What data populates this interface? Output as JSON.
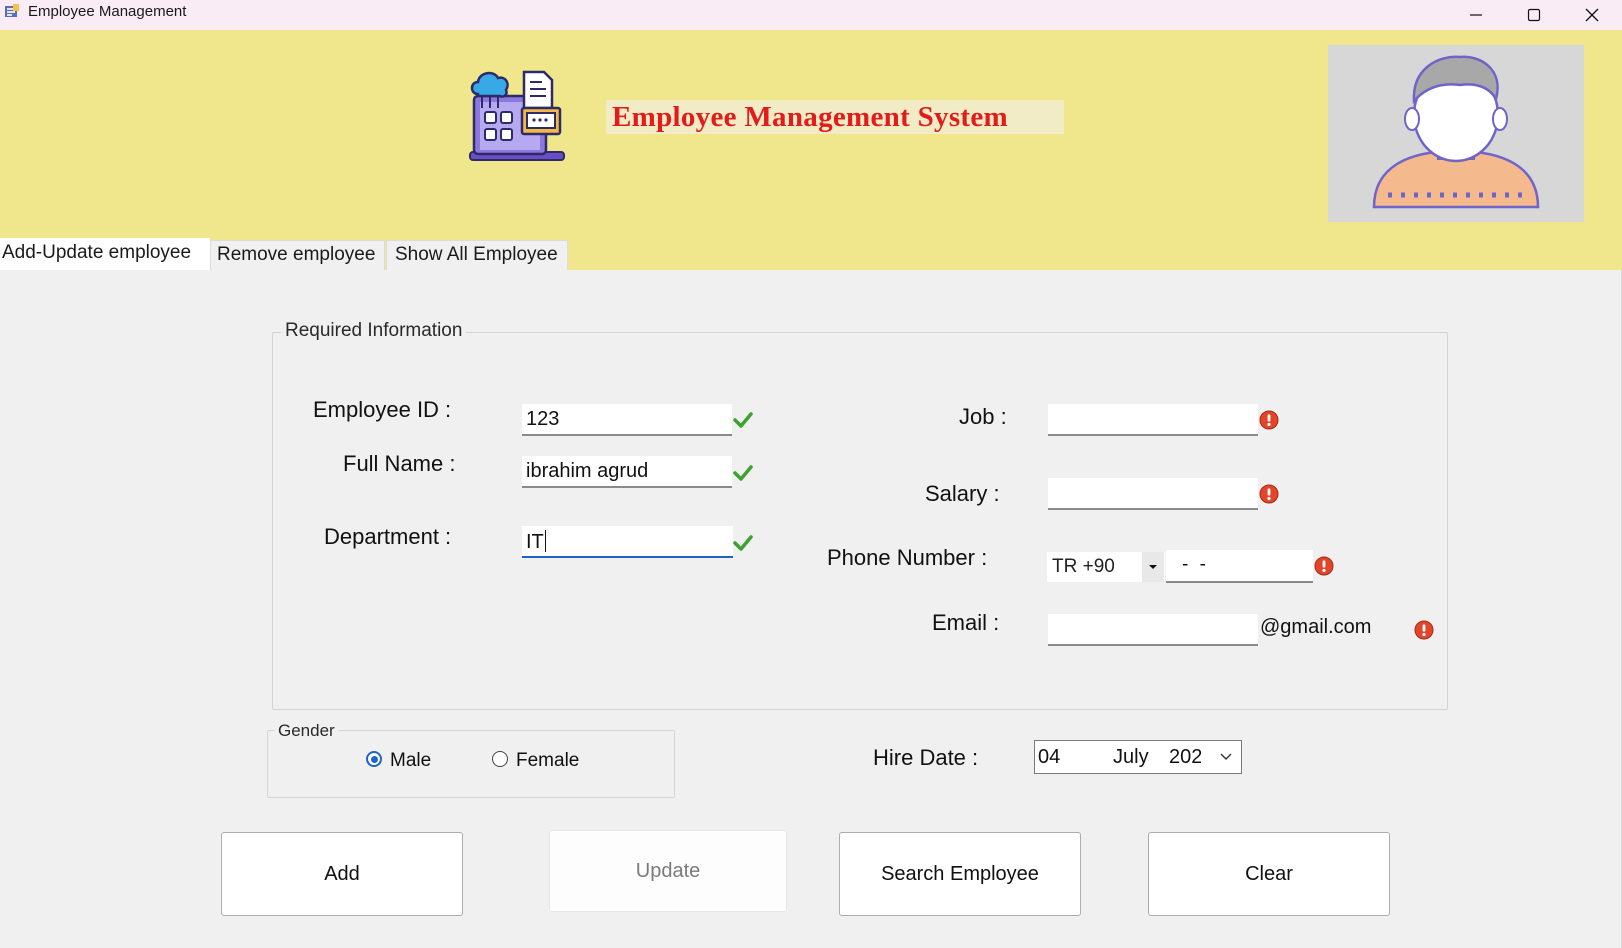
{
  "window": {
    "title": "Employee Management",
    "controls": {
      "minimize_icon": "minimize-icon",
      "maximize_icon": "maximize-icon",
      "close_icon": "close-icon"
    }
  },
  "header": {
    "app_title": "Employee Management System",
    "logo_icon": "cloud-computing-laptop-icon",
    "avatar_icon": "user-avatar-icon",
    "background": "#f0e68c",
    "title_color": "#e41b1b"
  },
  "tabs": [
    {
      "label": "Add-Update employee",
      "active": true
    },
    {
      "label": "Remove employee",
      "active": false
    },
    {
      "label": "Show All Employee",
      "active": false
    }
  ],
  "required_info": {
    "legend": "Required Information",
    "employee_id": {
      "label": "Employee ID :",
      "value": "123",
      "valid": true
    },
    "full_name": {
      "label": "Full Name :",
      "value": "ibrahim agrud",
      "valid": true
    },
    "department": {
      "label": "Department :",
      "value": "IT",
      "valid": true
    },
    "job": {
      "label": "Job :",
      "value": "",
      "valid": false
    },
    "salary": {
      "label": "Salary :",
      "value": "",
      "valid": false
    },
    "phone": {
      "label": "Phone Number :",
      "country_code": "TR +90",
      "mask": "- -",
      "valid": false
    },
    "email": {
      "label": "Email :",
      "value": "",
      "suffix": "@gmail.com",
      "valid": false
    }
  },
  "gender": {
    "legend": "Gender",
    "options": [
      {
        "label": "Male",
        "checked": true
      },
      {
        "label": "Female",
        "checked": false
      }
    ]
  },
  "hire_date": {
    "label": "Hire Date :",
    "day": "04",
    "month": "July",
    "year": "202"
  },
  "buttons": {
    "add": "Add",
    "update": "Update",
    "search": "Search Employee",
    "clear": "Clear"
  },
  "colors": {
    "valid_check": "#3da22f",
    "error": "#e2452a",
    "focus": "#1f63c4"
  }
}
